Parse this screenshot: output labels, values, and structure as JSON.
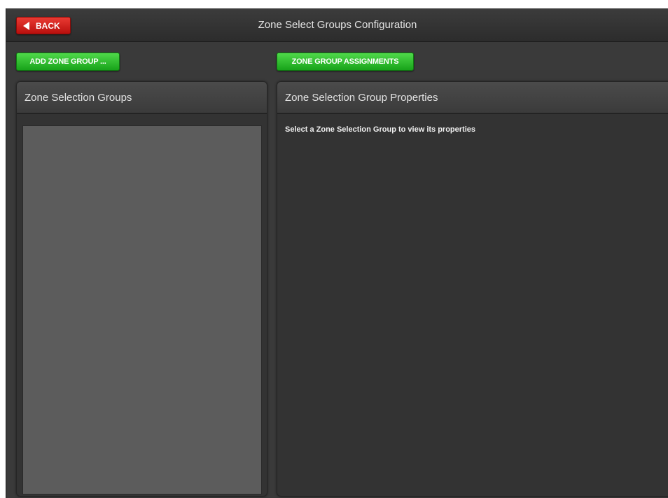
{
  "header": {
    "back_label": "BACK",
    "title": "Zone Select Groups Configuration"
  },
  "toolbar": {
    "add_zone_group_label": "ADD ZONE GROUP ...",
    "zone_group_assignments_label": "ZONE GROUP ASSIGNMENTS"
  },
  "left_panel": {
    "title": "Zone Selection Groups"
  },
  "right_panel": {
    "title": "Zone Selection Group Properties",
    "hint": "Select a Zone Selection Group to view its properties"
  },
  "colors": {
    "back_button": "#c81a16",
    "action_button": "#2bb82a",
    "background": "#3a3a3a",
    "list_background": "#5c5c5c"
  },
  "icons": {
    "back": "left-triangle-arrow-icon"
  }
}
